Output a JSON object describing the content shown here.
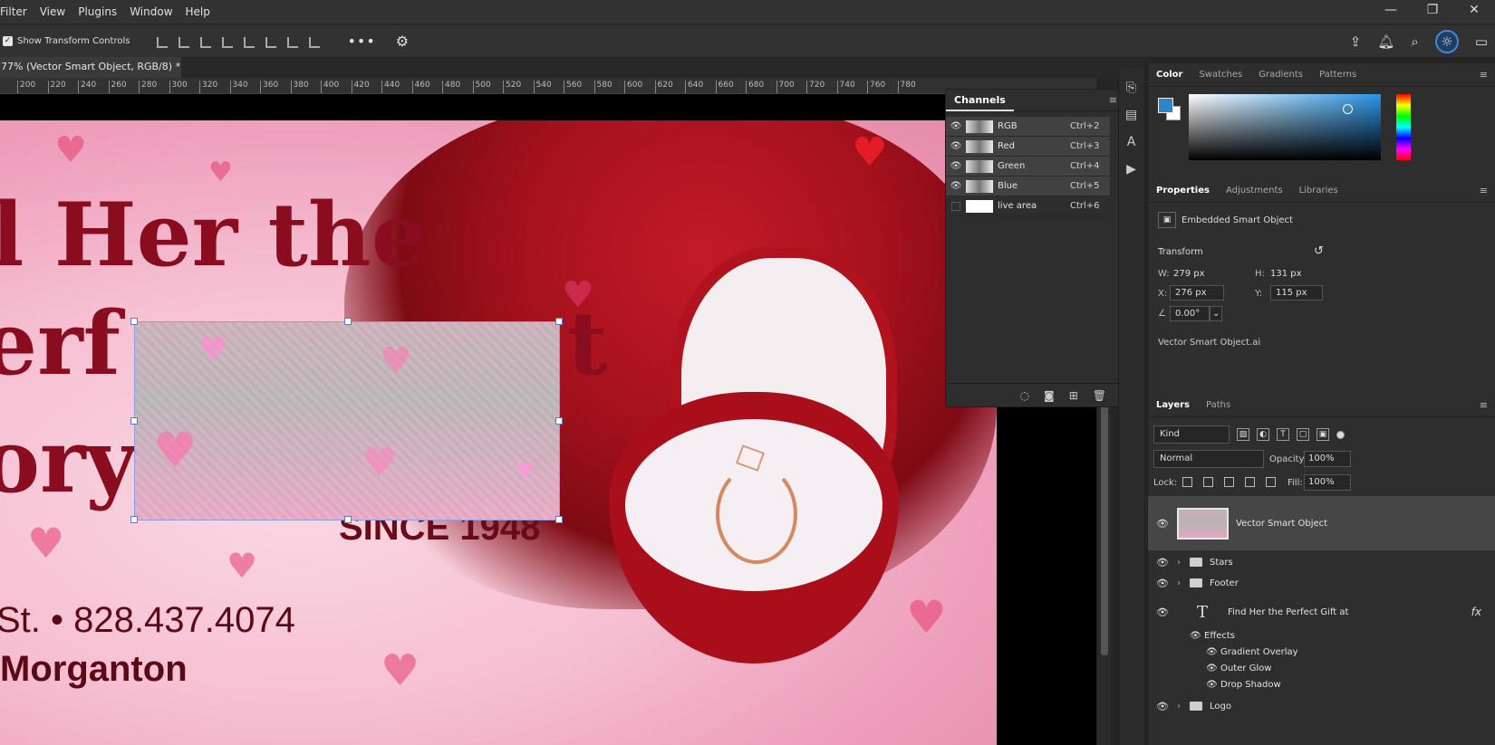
{
  "menubar": {
    "items": [
      "Filter",
      "View",
      "Plugins",
      "Window",
      "Help"
    ],
    "window_controls": [
      "—",
      "❐",
      "✕"
    ]
  },
  "options": {
    "show_transform_label": "Show Transform Controls",
    "more": "•••",
    "gear": "⚙"
  },
  "document": {
    "tab_title": "77% (Vector Smart Object, RGB/8) *",
    "tab_close": "×"
  },
  "ruler": {
    "ticks": [
      "200",
      "220",
      "240",
      "260",
      "280",
      "300",
      "320",
      "340",
      "360",
      "380",
      "400",
      "420",
      "440",
      "460",
      "480",
      "500",
      "520",
      "540",
      "560",
      "580",
      "600",
      "620",
      "640",
      "660",
      "680",
      "700",
      "720",
      "740",
      "760",
      "780"
    ]
  },
  "canvas": {
    "headline_line1": "l Her the",
    "headline_line2": "erf",
    "headline_line2_end": "t",
    "headline_line3": "ory",
    "since": "SINCE 1948",
    "phone": "St. • 828.437.4074",
    "city": "Morganton"
  },
  "channels": {
    "title": "Channels",
    "rows": [
      {
        "name": "RGB",
        "shortcut": "Ctrl+2"
      },
      {
        "name": "Red",
        "shortcut": "Ctrl+3"
      },
      {
        "name": "Green",
        "shortcut": "Ctrl+4"
      },
      {
        "name": "Blue",
        "shortcut": "Ctrl+5"
      },
      {
        "name": "live area",
        "shortcut": "Ctrl+6"
      }
    ]
  },
  "color_panel": {
    "tabs": [
      "Color",
      "Swatches",
      "Gradients",
      "Patterns"
    ],
    "foreground_color": "#2d85cc",
    "background_color": "#ffffff"
  },
  "properties": {
    "tabs": [
      "Properties",
      "Adjustments",
      "Libraries"
    ],
    "type": "Embedded Smart Object",
    "section": "Transform",
    "w_label": "W:",
    "w_value": "279 px",
    "h_label": "H:",
    "h_value": "131 px",
    "x_label": "X:",
    "x_value": "276 px",
    "y_label": "Y:",
    "y_value": "115 px",
    "angle": "0.00°",
    "file": "Vector Smart Object.ai"
  },
  "layers": {
    "tabs": [
      "Layers",
      "Paths"
    ],
    "kind": "Kind",
    "blend_mode": "Normal",
    "opacity_label": "Opacity:",
    "opacity": "100%",
    "lock_label": "Lock:",
    "fill_label": "Fill:",
    "fill": "100%",
    "items": {
      "smart": "Vector Smart Object",
      "stars": "Stars",
      "footer": "Footer",
      "text": "Find Her the    Perfect Gift at",
      "effects": "Effects",
      "gradient_overlay": "Gradient Overlay",
      "outer_glow": "Outer Glow",
      "drop_shadow": "Drop Shadow",
      "logo": "Logo"
    }
  }
}
